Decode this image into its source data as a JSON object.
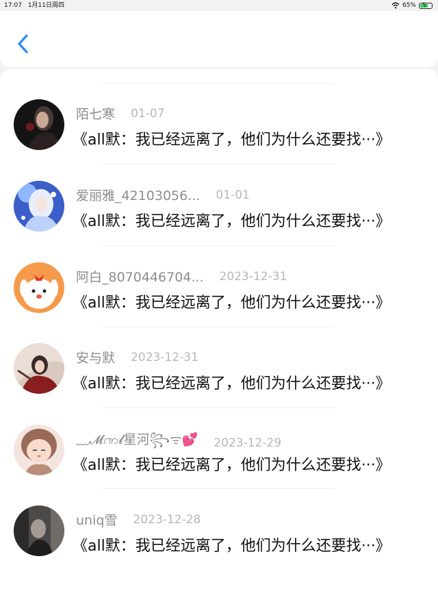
{
  "status_bar": {
    "time": "17:07",
    "date": "1月11日周四",
    "battery": "65%"
  },
  "comments": [
    {
      "name": "陌七寒",
      "date": "01-07",
      "text": "《all默：我已经远离了，他们为什么还要找···》"
    },
    {
      "name": "爱丽雅_42103056...",
      "date": "01-01",
      "text": "《all默：我已经远离了，他们为什么还要找···》"
    },
    {
      "name": "阿白_8070446704...",
      "date": "2023-12-31",
      "text": "《all默：我已经远离了，他们为什么还要找···》"
    },
    {
      "name": "安与默",
      "date": "2023-12-31",
      "text": "《all默：我已经远离了，他们为什么还要找···》"
    },
    {
      "name": "﹏𝓜ၮ𝓵星河꧂ᯤ💕",
      "date": "2023-12-29",
      "text": "《all默：我已经远离了，他们为什么还要找···》"
    },
    {
      "name": "uniq雪",
      "date": "2023-12-28",
      "text": "《all默：我已经远离了，他们为什么还要找···》"
    }
  ]
}
